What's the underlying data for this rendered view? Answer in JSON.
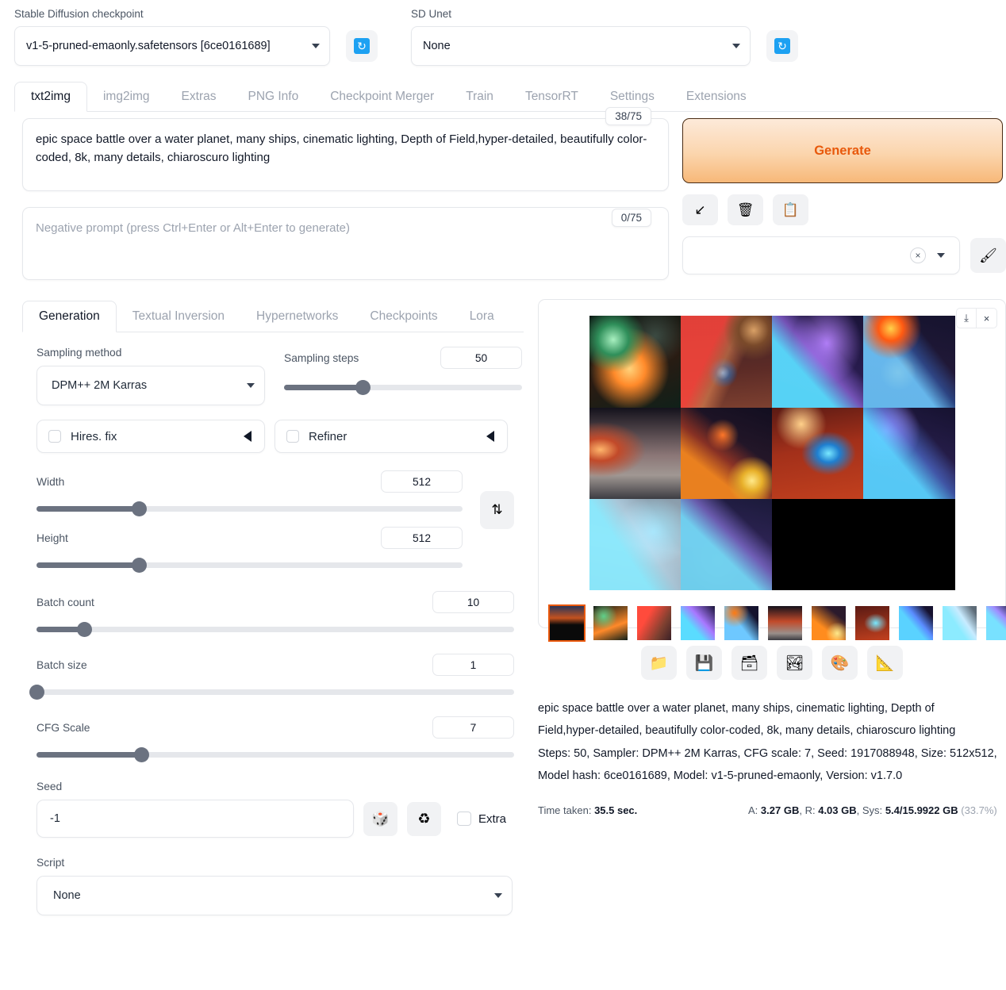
{
  "top": {
    "checkpoint_label": "Stable Diffusion checkpoint",
    "checkpoint_value": "v1-5-pruned-emaonly.safetensors [6ce0161689]",
    "unet_label": "SD Unet",
    "unet_value": "None",
    "refresh_icon": "refresh-icon",
    "refresh_glyph": "↻"
  },
  "tabs": [
    {
      "label": "txt2img",
      "active": true
    },
    {
      "label": "img2img",
      "active": false
    },
    {
      "label": "Extras",
      "active": false
    },
    {
      "label": "PNG Info",
      "active": false
    },
    {
      "label": "Checkpoint Merger",
      "active": false
    },
    {
      "label": "Train",
      "active": false
    },
    {
      "label": "TensorRT",
      "active": false
    },
    {
      "label": "Settings",
      "active": false
    },
    {
      "label": "Extensions",
      "active": false
    }
  ],
  "prompt": {
    "positive_value": "epic space battle over a water planet, many ships, cinematic lighting, Depth of Field,hyper-detailed, beautifully color-coded, 8k, many details, chiaroscuro lighting",
    "positive_tokens": "38/75",
    "negative_placeholder": "Negative prompt (press Ctrl+Enter or Alt+Enter to generate)",
    "negative_value": "",
    "negative_tokens": "0/75"
  },
  "actions": {
    "generate_label": "Generate",
    "read_params_icon": "↙",
    "clear_prompt_icon": "🗑",
    "apply_style_icon": "📋",
    "styles_value": "",
    "styles_clear_icon": "×",
    "edit_styles_icon": "🖌"
  },
  "subtabs": [
    {
      "label": "Generation",
      "active": true
    },
    {
      "label": "Textual Inversion",
      "active": false
    },
    {
      "label": "Hypernetworks",
      "active": false
    },
    {
      "label": "Checkpoints",
      "active": false
    },
    {
      "label": "Lora",
      "active": false
    }
  ],
  "params": {
    "sampling_method_label": "Sampling method",
    "sampling_method_value": "DPM++ 2M Karras",
    "sampling_steps_label": "Sampling steps",
    "sampling_steps_value": "50",
    "sampling_steps_pct": 33,
    "hires_label": "Hires. fix",
    "refiner_label": "Refiner",
    "width_label": "Width",
    "width_value": "512",
    "width_pct": 24,
    "height_label": "Height",
    "height_value": "512",
    "height_pct": 24,
    "swap_icon": "⇅",
    "batch_count_label": "Batch count",
    "batch_count_value": "10",
    "batch_count_pct": 10,
    "batch_size_label": "Batch size",
    "batch_size_value": "1",
    "batch_size_pct": 0,
    "cfg_label": "CFG Scale",
    "cfg_value": "7",
    "cfg_pct": 22,
    "seed_label": "Seed",
    "seed_value": "-1",
    "random_seed_icon": "🎲",
    "reuse_seed_icon": "♻",
    "extra_label": "Extra",
    "script_label": "Script",
    "script_value": "None"
  },
  "gallery": {
    "download_icon": "⤓",
    "close_icon": "×",
    "selected_thumb_index": 0,
    "tools": [
      {
        "name": "open-folder-button",
        "icon": "📁"
      },
      {
        "name": "save-button",
        "icon": "💾"
      },
      {
        "name": "save-zip-button",
        "icon": "🗃"
      },
      {
        "name": "send-to-img2img-button",
        "icon": "🏞"
      },
      {
        "name": "send-to-extras-button",
        "icon": "🎨"
      },
      {
        "name": "send-to-inpaint-button",
        "icon": "📐"
      }
    ]
  },
  "infotext": {
    "prompt_line": "epic space battle over a water planet, many ships, cinematic lighting, Depth of Field,hyper-detailed, beautifully color-coded, 8k, many details, chiaroscuro lighting",
    "params_line": "Steps: 50, Sampler: DPM++ 2M Karras, CFG scale: 7, Seed: 1917088948, Size: 512x512, Model hash: 6ce0161689, Model: v1-5-pruned-emaonly, Version: v1.7.0"
  },
  "perf": {
    "time_label": "Time taken:",
    "time_value": "35.5 sec.",
    "a_label": "A:",
    "a_value": "3.27 GB",
    "r_label": "R:",
    "r_value": "4.03 GB",
    "sys_label": "Sys:",
    "sys_value": "5.4/15.9922 GB",
    "sys_pct": "(33.7%)"
  },
  "colors": {
    "accent_orange": "#ea580c",
    "generate_border": "#4a2c14",
    "refresh_blue": "#1da1f2",
    "slider_fill": "#6b7280"
  }
}
